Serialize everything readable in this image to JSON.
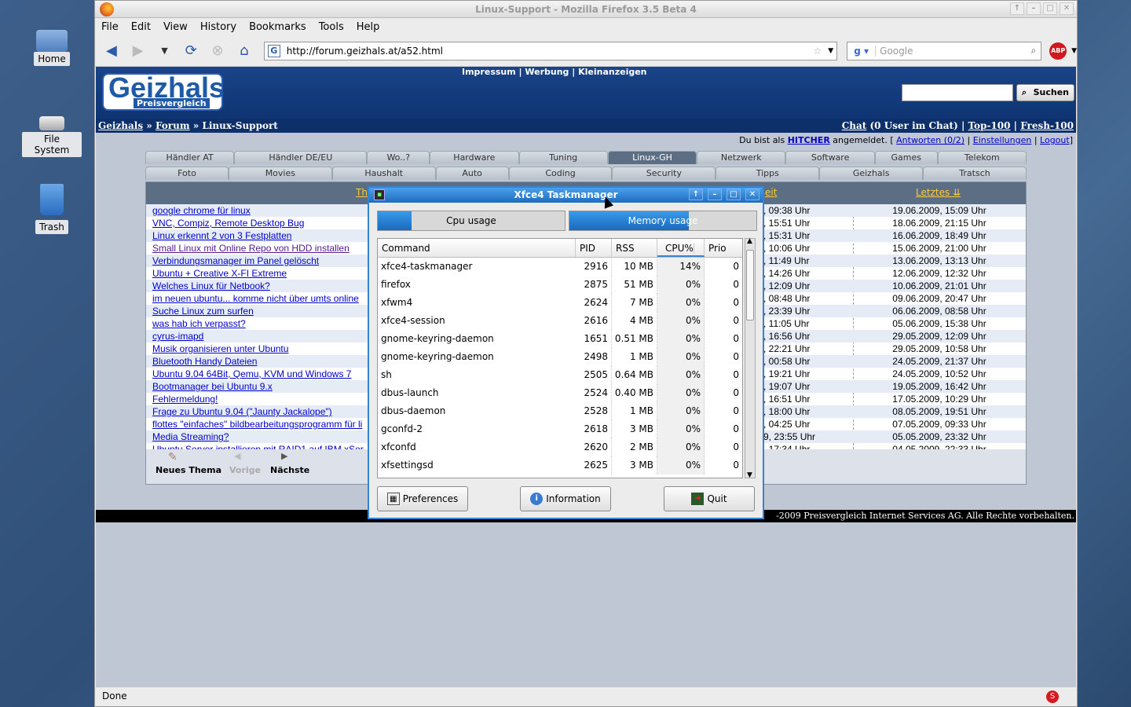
{
  "desktop": {
    "icons": [
      {
        "label": "Home"
      },
      {
        "label": "File System"
      },
      {
        "label": "Trash"
      }
    ]
  },
  "firefox": {
    "title": "Linux-Support - Mozilla Firefox 3.5 Beta 4",
    "menu": [
      "File",
      "Edit",
      "View",
      "History",
      "Bookmarks",
      "Tools",
      "Help"
    ],
    "url": "http://forum.geizhals.at/a52.html",
    "search_placeholder": "Google",
    "adblock": "ABP",
    "status": "Done"
  },
  "site": {
    "logo": "Geizhals",
    "logo_sub": "Preisvergleich",
    "toplinks": "Impressum | Werbung | Kleinanzeigen",
    "search_button": "Suchen",
    "breadcrumb": {
      "a": "Geizhals",
      "sep1": " » ",
      "b": "Forum",
      "sep2": " » ",
      "c": "Linux-Support"
    },
    "chat_links": {
      "chat": "Chat",
      "chat_info": " (0 User im Chat) | ",
      "top": "Top-100",
      "sep": " | ",
      "fresh": "Fresh-100"
    },
    "userbar": {
      "prefix": "Du bist als ",
      "user": "HITCHER",
      "mid": " angemeldet. [ ",
      "answers": "Antworten (0/2)",
      "s1": " | ",
      "settings": "Einstellungen",
      "s2": " | ",
      "logout": "Logout",
      "end": "]"
    },
    "tabs_row1": [
      "Händler AT",
      "Händler DE/EU",
      "Wo..?",
      "Hardware",
      "Tuning",
      "Linux-GH",
      "Netzwerk",
      "Software",
      "Games",
      "Telekom"
    ],
    "tabs_row2": [
      "Foto",
      "Movies",
      "Haushalt",
      "Auto",
      "Coding",
      "Security",
      "Tipps",
      "Geizhals",
      "Tratsch"
    ],
    "active_tab": "Linux-GH",
    "col_thema": "Th",
    "col_mid": "eit",
    "col_letztes": "Letztes",
    "threads": [
      {
        "title": "google chrome für linux",
        "mid": ", 09:38 Uhr",
        "last": "19.06.2009, 15:09 Uhr"
      },
      {
        "title": "VNC, Compiz, Remote Desktop Bug",
        "mid": ", 15:51 Uhr",
        "last": "18.06.2009, 21:15 Uhr"
      },
      {
        "title": "Linux erkennt 2 von 3 Festplatten",
        "mid": ", 15:31 Uhr",
        "last": "16.06.2009, 18:49 Uhr"
      },
      {
        "title": "Small Linux mit Online Repo von HDD installen",
        "mid": ", 10:06 Uhr",
        "last": "15.06.2009, 21:00 Uhr",
        "visited": true
      },
      {
        "title": "Verbindungsmanager im Panel gelöscht",
        "mid": ", 11:49 Uhr",
        "last": "13.06.2009, 13:13 Uhr"
      },
      {
        "title": "Ubuntu + Creative X-FI Extreme",
        "mid": ", 14:26 Uhr",
        "last": "12.06.2009, 12:32 Uhr"
      },
      {
        "title": "Welches Linux für Netbook?",
        "mid": ", 12:09 Uhr",
        "last": "10.06.2009, 21:01 Uhr"
      },
      {
        "title": "im neuen ubuntu... komme nicht über umts online",
        "mid": ", 08:48 Uhr",
        "last": "09.06.2009, 20:47 Uhr"
      },
      {
        "title": "Suche Linux zum surfen",
        "mid": ", 23:39 Uhr",
        "last": "06.06.2009, 08:58 Uhr"
      },
      {
        "title": "was hab ich verpasst?",
        "mid": ", 11:05 Uhr",
        "last": "05.06.2009, 15:38 Uhr"
      },
      {
        "title": "cyrus-imapd",
        "mid": ", 16:56 Uhr",
        "last": "29.05.2009, 12:09 Uhr"
      },
      {
        "title": "Musik organisieren unter Ubuntu",
        "mid": ", 22:21 Uhr",
        "last": "29.05.2009, 10:58 Uhr"
      },
      {
        "title": "Bluetooth Handy Dateien",
        "mid": ", 00:58 Uhr",
        "last": "24.05.2009, 21:37 Uhr"
      },
      {
        "title": "Ubuntu 9.04 64Bit, Qemu, KVM und Windows 7",
        "mid": ", 19:21 Uhr",
        "last": "24.05.2009, 10:52 Uhr"
      },
      {
        "title": "Bootmanager bei Ubuntu 9.x",
        "mid": ", 19:07 Uhr",
        "last": "19.05.2009, 16:42 Uhr"
      },
      {
        "title": "Fehlermeldung!",
        "mid": ", 16:51 Uhr",
        "last": "17.05.2009, 10:29 Uhr"
      },
      {
        "title": "Frage zu Ubuntu 9.04 (\"Jaunty Jackalope\")",
        "mid": ", 18:00 Uhr",
        "last": "08.05.2009, 19:51 Uhr"
      },
      {
        "title": "flottes \"einfaches\" bildbearbeitungsprogramm für li",
        "mid": ", 04:25 Uhr",
        "last": "07.05.2009, 09:33 Uhr"
      },
      {
        "title": "Media Streaming?",
        "mid": "9, 23:55 Uhr",
        "last": "05.05.2009, 23:32 Uhr"
      },
      {
        "title": "Ubuntu Server installieren mit RAID1 auf IBM xSer",
        "mid": ", 17:34 Uhr",
        "last": "04.05.2009, 22:33 Uhr"
      }
    ],
    "pager": {
      "new": "Neues Thema",
      "prev": "Vorige",
      "next": "Nächste"
    },
    "footer": "-2009 Preisvergleich Internet Services AG. Alle Rechte vorbehalten."
  },
  "taskmanager": {
    "title": "Xfce4 Taskmanager",
    "cpu_label": "Cpu usage",
    "cpu_fraction": 0.18,
    "mem_label": "Memory usage",
    "mem_fraction": 0.64,
    "columns": [
      "Command",
      "PID",
      "RSS",
      "CPU%",
      "Prio"
    ],
    "processes": [
      {
        "cmd": "xfce4-taskmanager",
        "pid": "2916",
        "rss": "10 MB",
        "cpu": "14%",
        "prio": "0"
      },
      {
        "cmd": "firefox",
        "pid": "2875",
        "rss": "51 MB",
        "cpu": "0%",
        "prio": "0"
      },
      {
        "cmd": "xfwm4",
        "pid": "2624",
        "rss": "7 MB",
        "cpu": "0%",
        "prio": "0"
      },
      {
        "cmd": "xfce4-session",
        "pid": "2616",
        "rss": "4 MB",
        "cpu": "0%",
        "prio": "0"
      },
      {
        "cmd": "gnome-keyring-daemon",
        "pid": "1651",
        "rss": "0.51 MB",
        "cpu": "0%",
        "prio": "0"
      },
      {
        "cmd": "gnome-keyring-daemon",
        "pid": "2498",
        "rss": "1 MB",
        "cpu": "0%",
        "prio": "0"
      },
      {
        "cmd": "sh",
        "pid": "2505",
        "rss": "0.64 MB",
        "cpu": "0%",
        "prio": "0"
      },
      {
        "cmd": "dbus-launch",
        "pid": "2524",
        "rss": "0.40 MB",
        "cpu": "0%",
        "prio": "0"
      },
      {
        "cmd": "dbus-daemon",
        "pid": "2528",
        "rss": "1 MB",
        "cpu": "0%",
        "prio": "0"
      },
      {
        "cmd": "gconfd-2",
        "pid": "2618",
        "rss": "3 MB",
        "cpu": "0%",
        "prio": "0"
      },
      {
        "cmd": "xfconfd",
        "pid": "2620",
        "rss": "2 MB",
        "cpu": "0%",
        "prio": "0"
      },
      {
        "cmd": "xfsettingsd",
        "pid": "2625",
        "rss": "3 MB",
        "cpu": "0%",
        "prio": "0"
      }
    ],
    "buttons": {
      "prefs": "Preferences",
      "info": "Information",
      "quit": "Quit"
    }
  }
}
